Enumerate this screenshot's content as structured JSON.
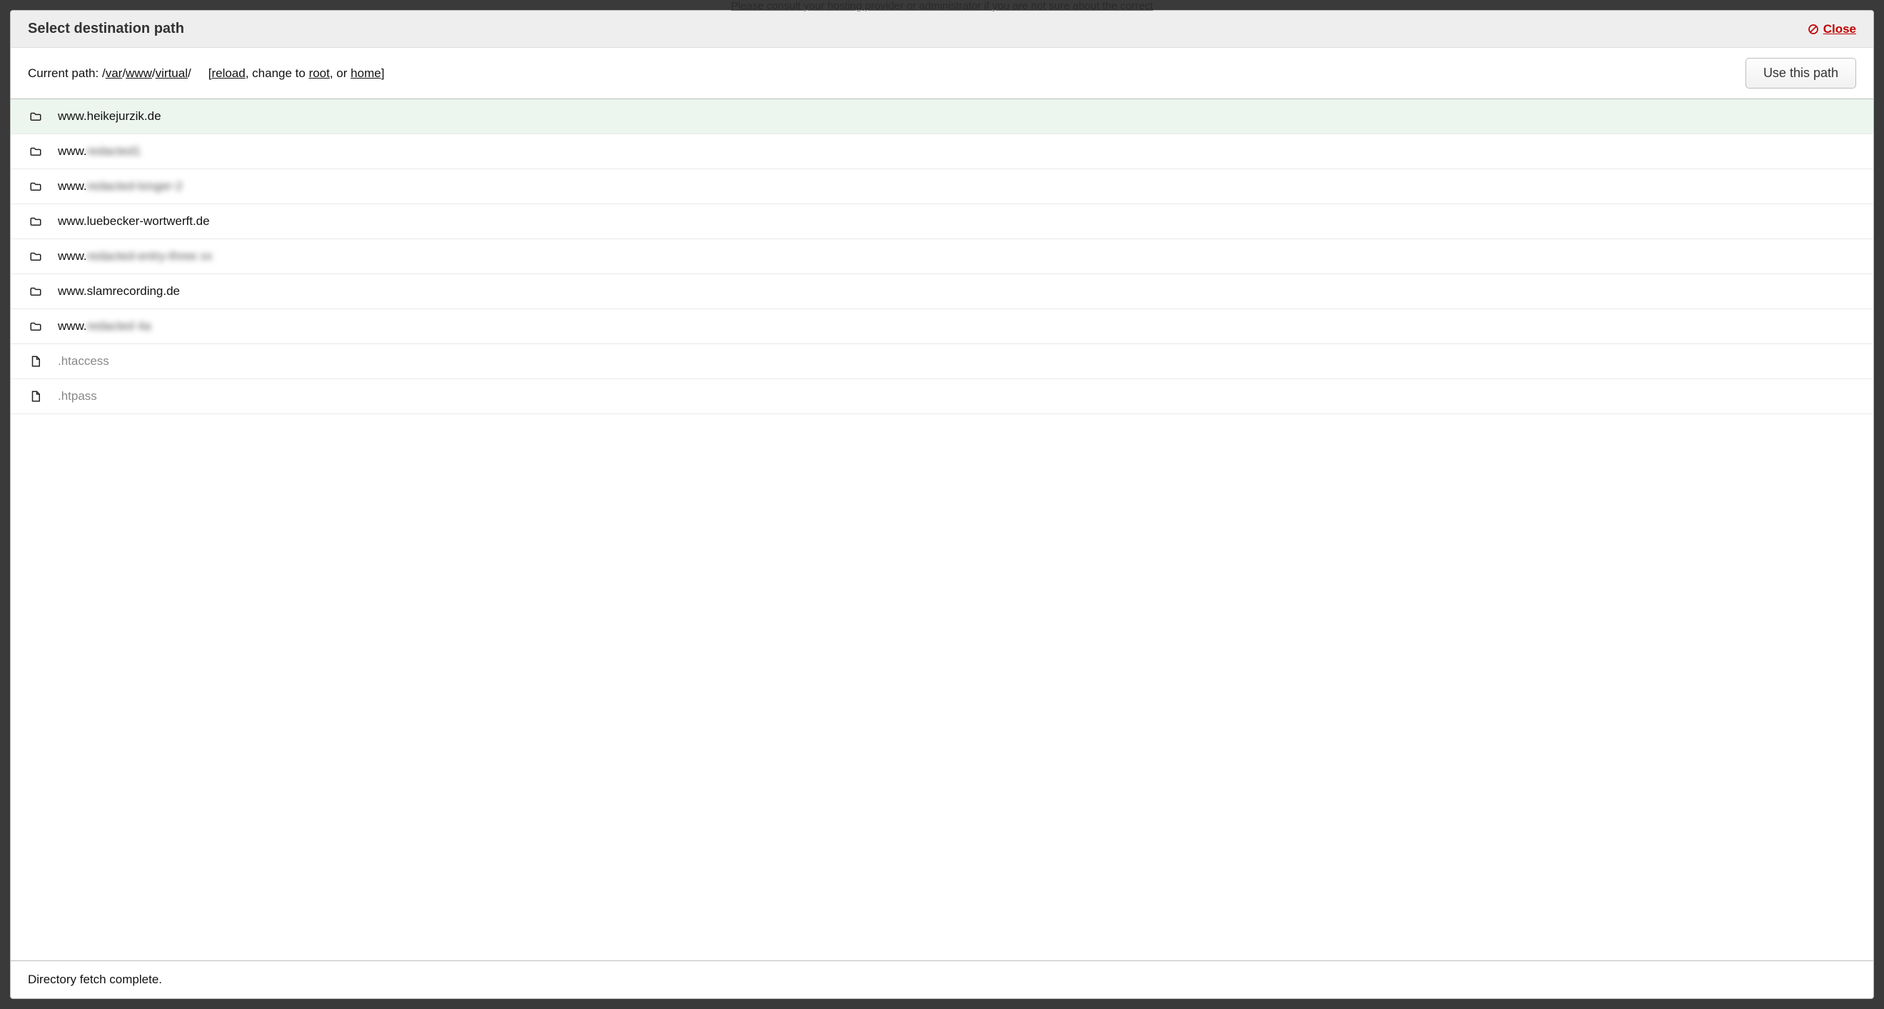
{
  "background_hint": "Please consult your hosting provider or administrator if you are not sure about the correct",
  "modal": {
    "title": "Select destination path",
    "close_label": "Close"
  },
  "toolbar": {
    "current_path_label": "Current path: ",
    "path_prefix": "/",
    "segments": [
      "var",
      "www",
      "virtual"
    ],
    "path_suffix": "/",
    "nav_open": "[",
    "reload_label": "reload",
    "nav_sep1": ", change to ",
    "root_label": "root",
    "nav_sep2": ", or ",
    "home_label": "home",
    "nav_close": "]",
    "use_path_label": "Use this path"
  },
  "list": [
    {
      "type": "folder",
      "selected": true,
      "prefix": "www.heikejurzik.de",
      "blurred_suffix": ""
    },
    {
      "type": "folder",
      "selected": false,
      "prefix": "www.",
      "blurred_suffix": "redacted1"
    },
    {
      "type": "folder",
      "selected": false,
      "prefix": "www.",
      "blurred_suffix": "redacted-longer-2"
    },
    {
      "type": "folder",
      "selected": false,
      "prefix": "www.luebecker-wortwerft.de",
      "blurred_suffix": ""
    },
    {
      "type": "folder",
      "selected": false,
      "prefix": "www.",
      "blurred_suffix": "redacted-entry-three xx"
    },
    {
      "type": "folder",
      "selected": false,
      "prefix": "www.slamrecording.de",
      "blurred_suffix": ""
    },
    {
      "type": "folder",
      "selected": false,
      "prefix": "www.",
      "blurred_suffix": "redacted 4a"
    },
    {
      "type": "file",
      "selected": false,
      "prefix": ".htaccess",
      "blurred_suffix": ""
    },
    {
      "type": "file",
      "selected": false,
      "prefix": ".htpass",
      "blurred_suffix": ""
    }
  ],
  "status": "Directory fetch complete."
}
